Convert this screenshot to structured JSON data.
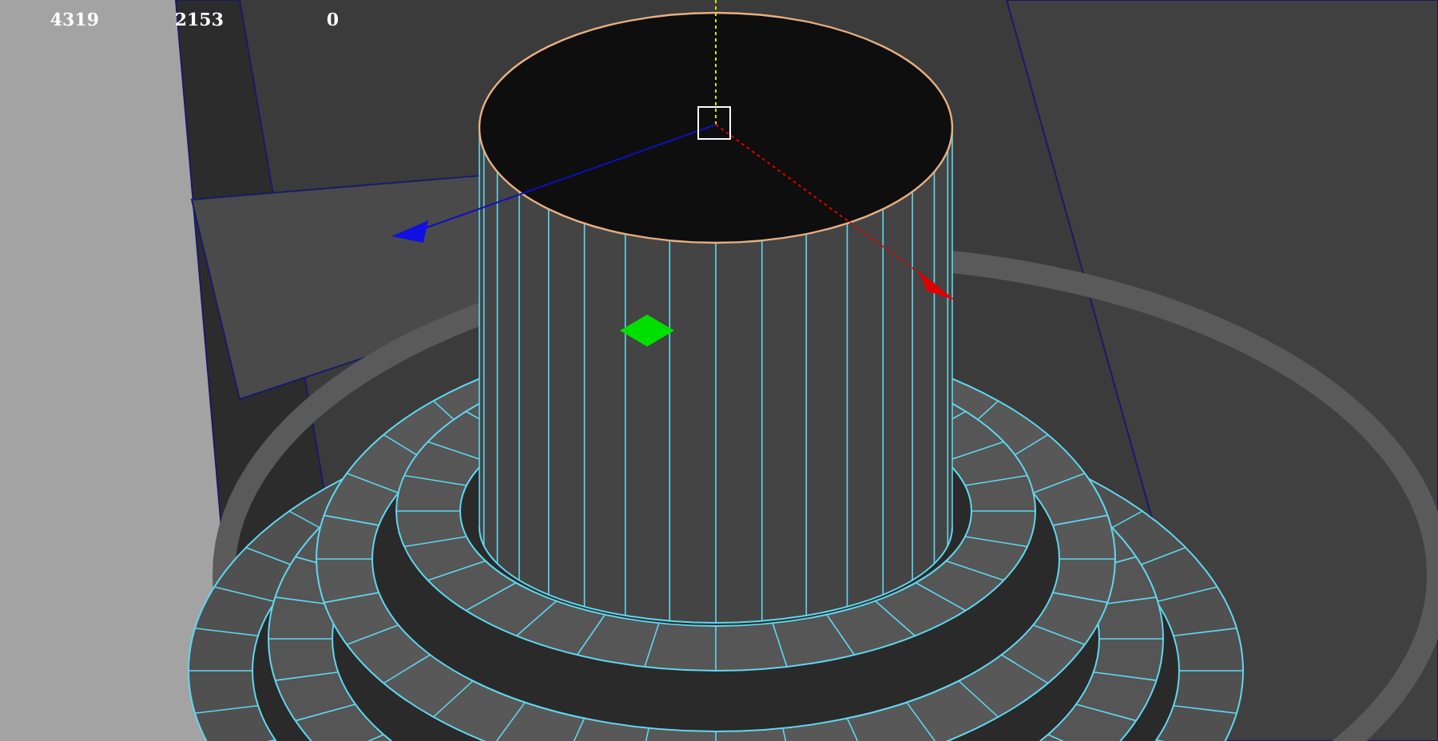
{
  "viewport": {
    "hud_counts": [
      "4319",
      "2153",
      "0"
    ]
  }
}
